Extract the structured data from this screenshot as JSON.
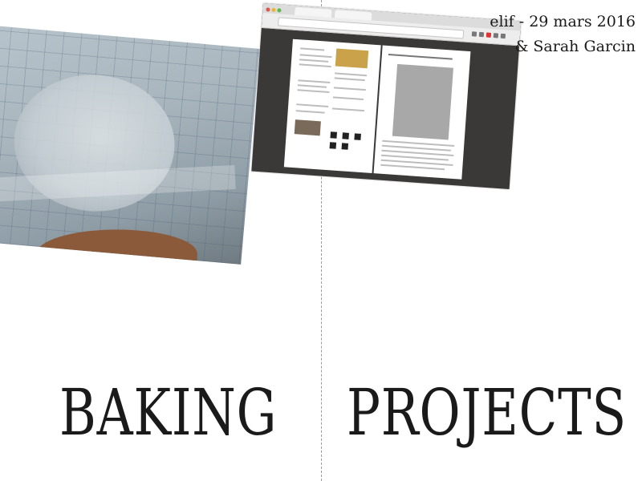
{
  "byline": {
    "line1": "elif - 29 mars 2016",
    "line2": "& Sarah Garcin"
  },
  "headline": {
    "word1": "BAKING",
    "word2": "PROJECTS"
  }
}
